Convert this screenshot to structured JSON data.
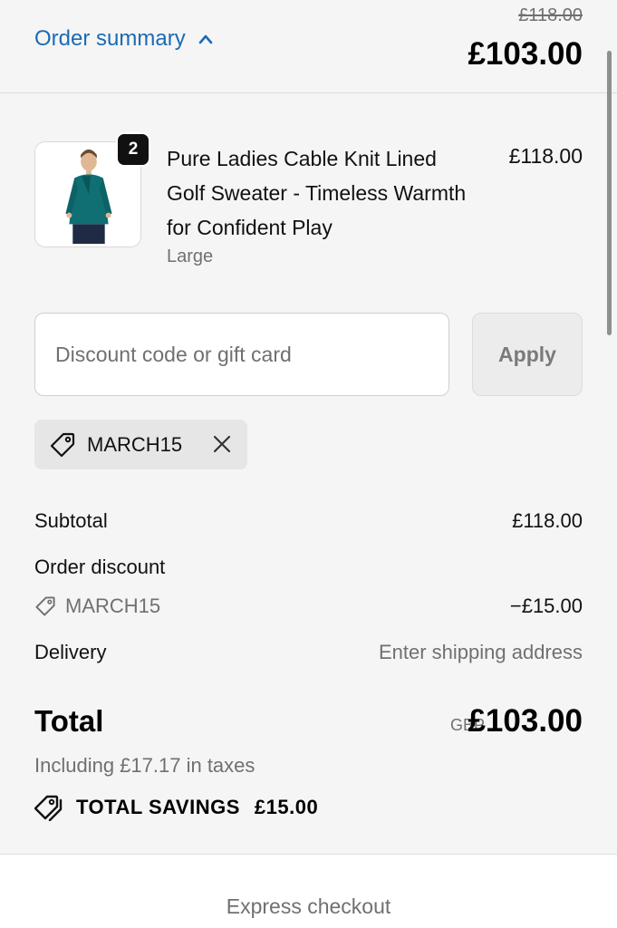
{
  "header": {
    "toggle_label": "Order summary",
    "original_price": "£118.00",
    "total": "£103.00"
  },
  "product": {
    "quantity": "2",
    "title": "Pure Ladies Cable Knit Lined Golf Sweater - Timeless Warmth for Confident Play",
    "variant": "Large",
    "price": "£118.00",
    "image_icon": "teal-sweater-model"
  },
  "discount": {
    "placeholder": "Discount code or gift card",
    "apply_label": "Apply",
    "applied_code": "MARCH15"
  },
  "summary": {
    "subtotal_label": "Subtotal",
    "subtotal_value": "£118.00",
    "order_discount_label": "Order discount",
    "discount_code": "MARCH15",
    "discount_value": "−£15.00",
    "delivery_label": "Delivery",
    "delivery_value": "Enter shipping address"
  },
  "total": {
    "label": "Total",
    "currency": "GBP",
    "amount": "£103.00",
    "tax_note": "Including £17.17 in taxes",
    "savings_label": "TOTAL SAVINGS",
    "savings_amount": "£15.00"
  },
  "express": {
    "label": "Express checkout"
  },
  "colors": {
    "link": "#1b6bb5",
    "panel_bg": "#f5f5f5",
    "muted_text": "#707070"
  }
}
